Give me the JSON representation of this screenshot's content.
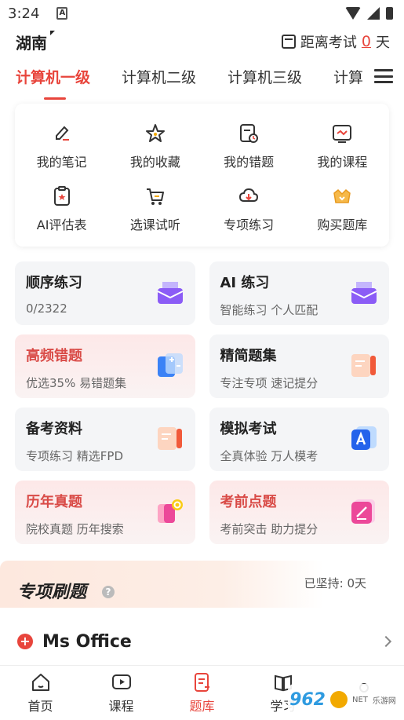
{
  "status_bar": {
    "time": "3:24"
  },
  "header": {
    "region": "湖南",
    "countdown_prefix": "距离考试",
    "countdown_days": "0",
    "countdown_unit": "天"
  },
  "tabs": [
    {
      "label": "计算机一级",
      "active": true
    },
    {
      "label": "计算机二级",
      "active": false
    },
    {
      "label": "计算机三级",
      "active": false
    },
    {
      "label": "计算",
      "active": false
    }
  ],
  "quick_actions": [
    {
      "label": "我的笔记",
      "icon": "note-edit-icon"
    },
    {
      "label": "我的收藏",
      "icon": "star-icon"
    },
    {
      "label": "我的错题",
      "icon": "wrong-questions-icon"
    },
    {
      "label": "我的课程",
      "icon": "course-icon"
    },
    {
      "label": "AI评估表",
      "icon": "ai-assessment-icon"
    },
    {
      "label": "选课试听",
      "icon": "cart-icon"
    },
    {
      "label": "专项练习",
      "icon": "download-cloud-icon"
    },
    {
      "label": "购买题库",
      "icon": "crown-shop-icon"
    }
  ],
  "cards": [
    {
      "title": "顺序练习",
      "subtitle": "0/2322",
      "style": "gray",
      "icon": "purple-box-icon"
    },
    {
      "title": "AI 练习",
      "subtitle": "智能练习 个人匹配",
      "style": "gray",
      "icon": "purple-box-icon"
    },
    {
      "title": "高频错题",
      "subtitle": "优选35% 易错题集",
      "style": "pink",
      "icon": "calculator-icon"
    },
    {
      "title": "精简题集",
      "subtitle": "专注专项 速记提分",
      "style": "gray",
      "icon": "orange-doc-icon"
    },
    {
      "title": "备考资料",
      "subtitle": "专项练习 精选FPD",
      "style": "gray",
      "icon": "orange-doc-icon"
    },
    {
      "title": "模拟考试",
      "subtitle": "全真体验 万人模考",
      "style": "gray",
      "icon": "blue-exam-icon"
    },
    {
      "title": "历年真题",
      "subtitle": "院校真题 历年搜索",
      "style": "pink",
      "icon": "search-doc-icon"
    },
    {
      "title": "考前点题",
      "subtitle": "考前突击 助力提分",
      "style": "pink",
      "icon": "pink-pen-icon"
    }
  ],
  "special": {
    "title": "专项刷题",
    "help": "?",
    "streak": "已坚持: 0天",
    "item": "Ms Office"
  },
  "bottom_nav": [
    {
      "label": "首页",
      "icon": "home-icon",
      "active": false
    },
    {
      "label": "课程",
      "icon": "video-icon",
      "active": false
    },
    {
      "label": "题库",
      "icon": "question-bank-icon",
      "active": true
    },
    {
      "label": "学习",
      "icon": "book-icon",
      "active": false
    },
    {
      "label": "",
      "icon": "profile-icon",
      "active": false
    }
  ],
  "watermark": {
    "brand": "962",
    "suffix": "NET",
    "site": "乐游网"
  },
  "colors": {
    "accent": "#e8453c",
    "card_gray": "#f4f5f7",
    "card_pink": "#fde8e8"
  }
}
